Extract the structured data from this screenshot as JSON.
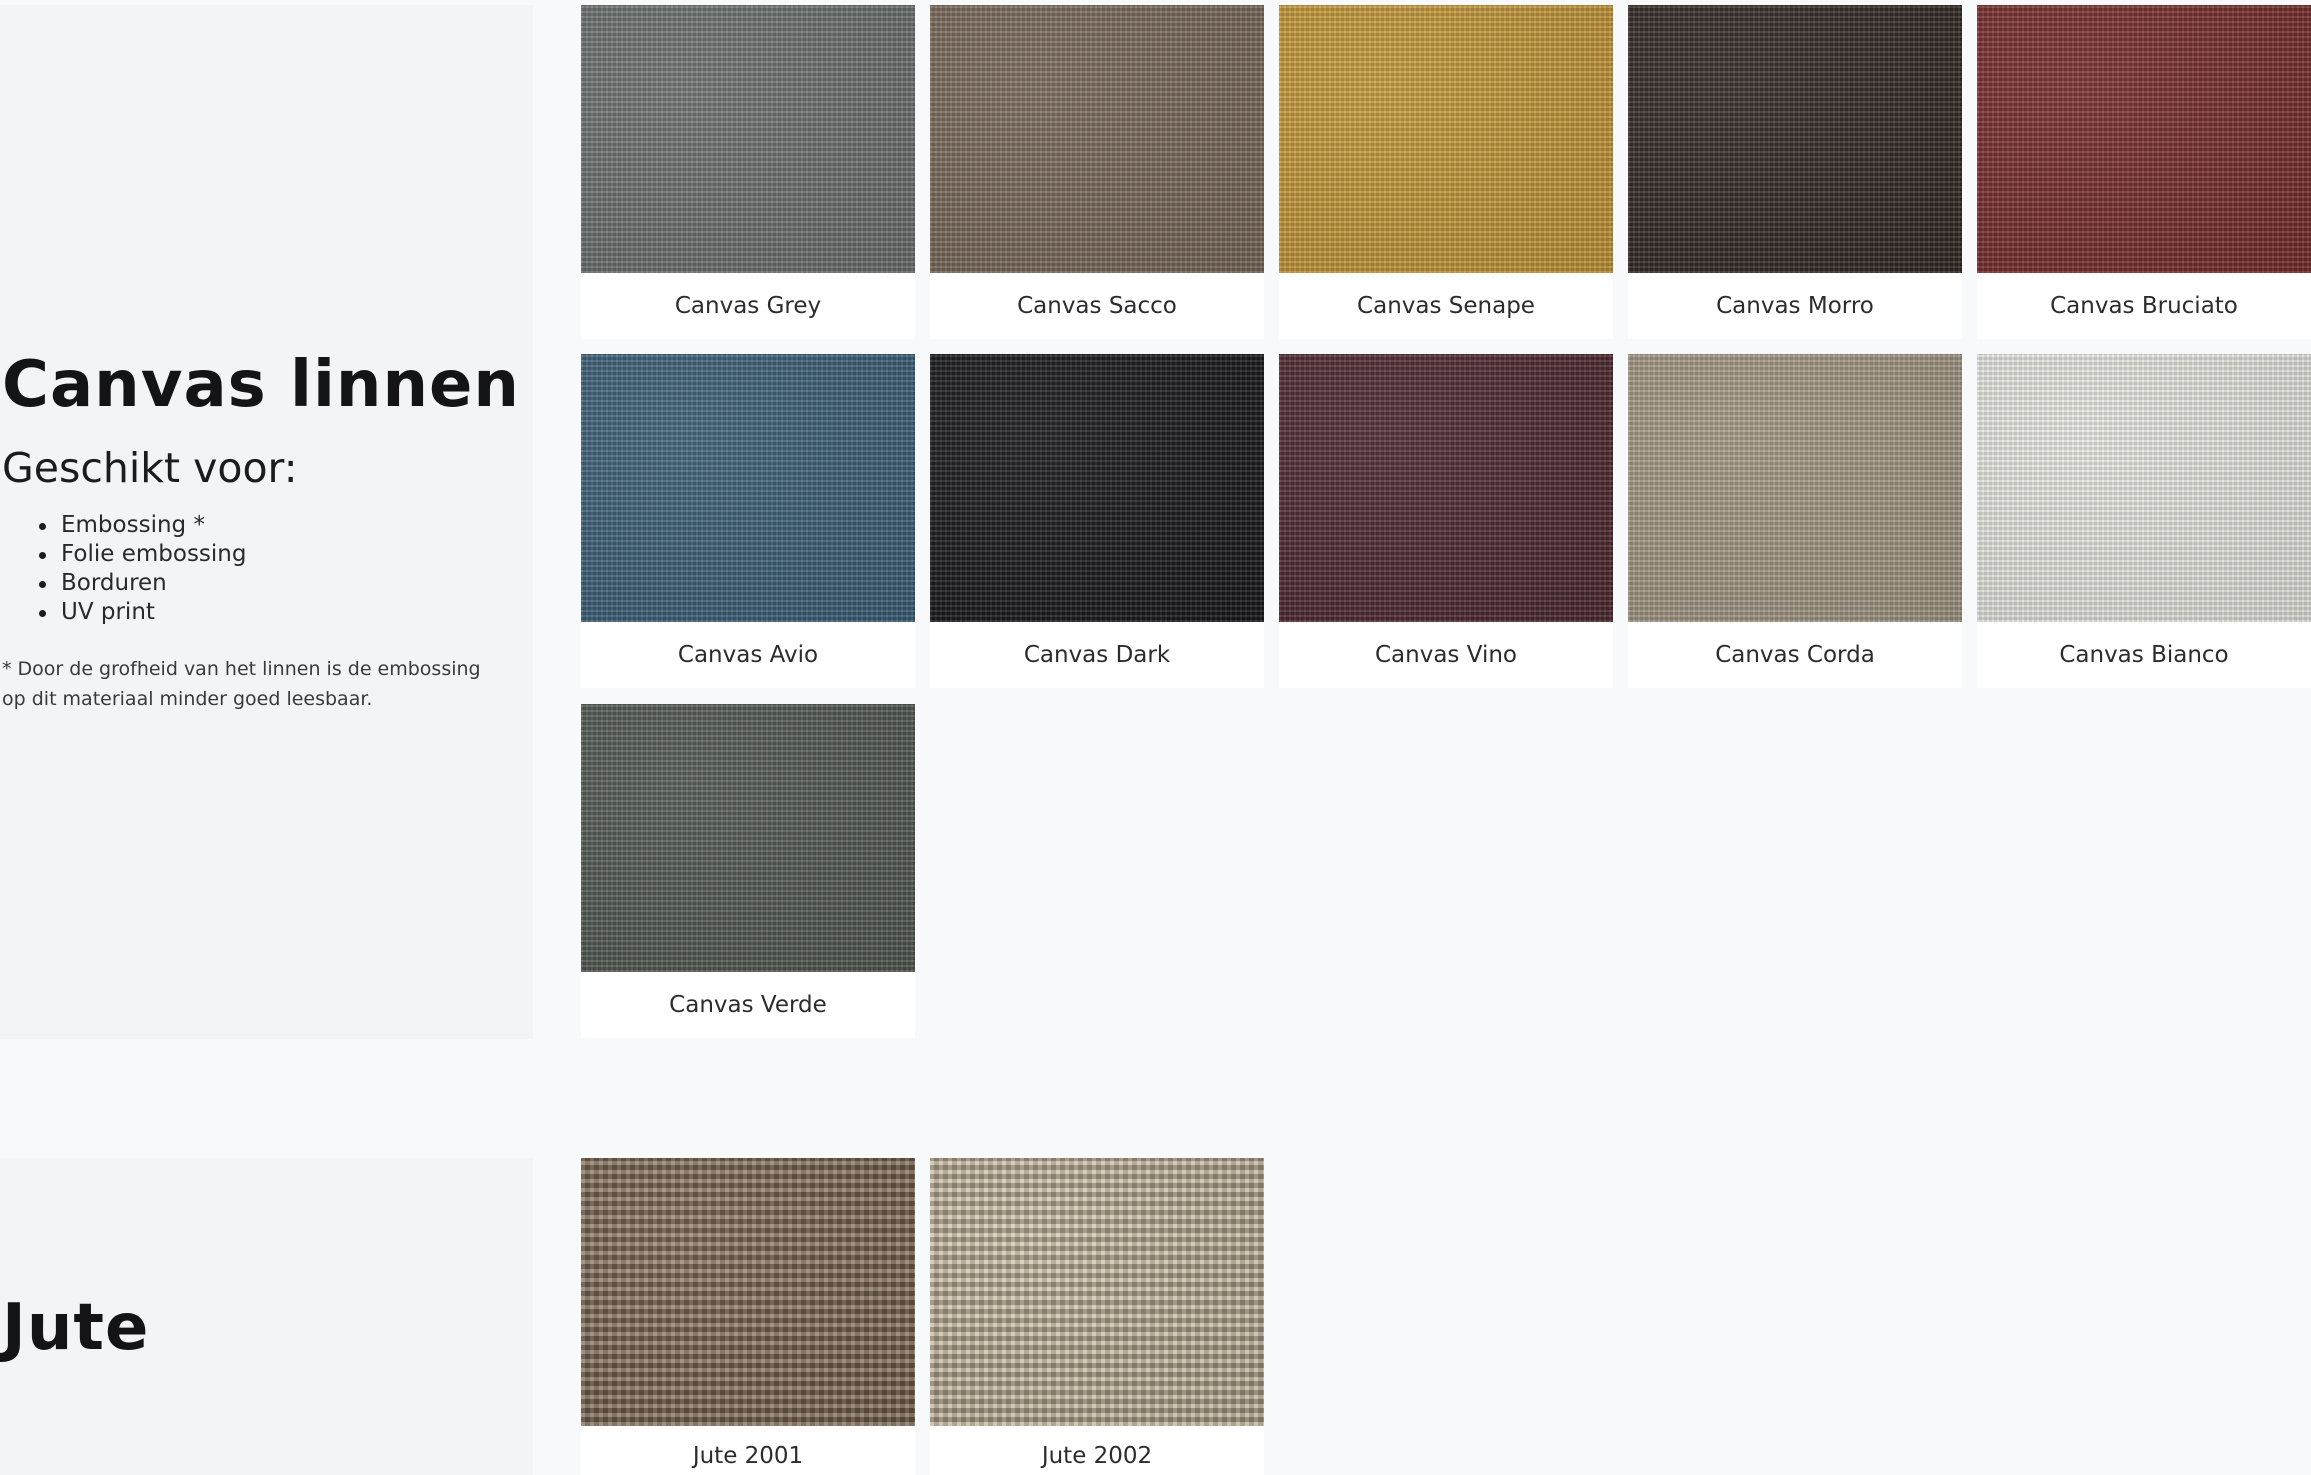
{
  "canvas_section": {
    "title": "Canvas linnen",
    "suited_heading": "Geschikt voor:",
    "uses": [
      "Embossing *",
      "Folie embossing",
      "Borduren",
      "UV print"
    ],
    "footnote": "* Door de grofheid van het linnen is de embossing op dit materiaal minder goed leesbaar.",
    "swatches": [
      {
        "name": "Canvas Grey",
        "color": "#6d7371"
      },
      {
        "name": "Canvas Sacco",
        "color": "#7b6a5b"
      },
      {
        "name": "Canvas Senape",
        "color": "#c99a3a"
      },
      {
        "name": "Canvas Morro",
        "color": "#352a26"
      },
      {
        "name": "Canvas Bruciato",
        "color": "#7a2d2d"
      },
      {
        "name": "Canvas Avio",
        "color": "#3d6178"
      },
      {
        "name": "Canvas Dark",
        "color": "#19191b"
      },
      {
        "name": "Canvas Vino",
        "color": "#4e2a30"
      },
      {
        "name": "Canvas Corda",
        "color": "#a59a88"
      },
      {
        "name": "Canvas Bianco",
        "color": "#ecece6"
      },
      {
        "name": "Canvas Verde",
        "color": "#535a53"
      }
    ]
  },
  "jute_section": {
    "title": "Jute",
    "swatches": [
      {
        "name": "Jute 2001",
        "color": "#8a735c"
      },
      {
        "name": "Jute 2002",
        "color": "#cfc2a6"
      }
    ]
  }
}
